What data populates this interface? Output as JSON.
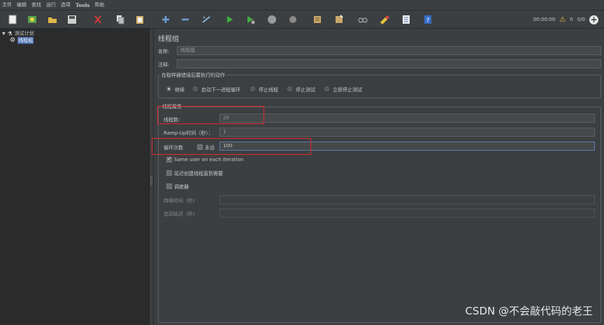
{
  "menu": [
    "文件",
    "编辑",
    "查找",
    "运行",
    "选项",
    "Tools",
    "帮助"
  ],
  "toolbar": {
    "timer": "00:00:00",
    "warnings": "0",
    "threads": "0/0"
  },
  "tree": {
    "root": "测试计划",
    "child": "线程组"
  },
  "panel": {
    "title": "线程组",
    "name_label": "名称:",
    "name_value": "线程组",
    "comment_label": "注释:",
    "comment_value": "",
    "error_group_title": "在取样器错误后要执行的动作",
    "error_actions": [
      "继续",
      "启动下一进程循环",
      "停止线程",
      "停止测试",
      "立即停止测试"
    ],
    "props_title": "线程属性",
    "threads_label": "线程数:",
    "threads_value": "20",
    "rampup_label": "Ramp-Up时间（秒）：",
    "rampup_value": "1",
    "loop_label": "循环次数",
    "forever_label": "永远",
    "loop_value": "100",
    "same_user_label": "Same user on each iteration",
    "delay_label": "延迟创建线程直到需要",
    "scheduler_label": "调度器",
    "duration_label": "持续时间（秒）",
    "duration_value": "",
    "startup_label": "启动延迟（秒）",
    "startup_value": ""
  },
  "colors": {
    "highlight": "#e0282e",
    "background": "#3c3f41"
  },
  "watermark": "CSDN @不会敲代码的老王"
}
